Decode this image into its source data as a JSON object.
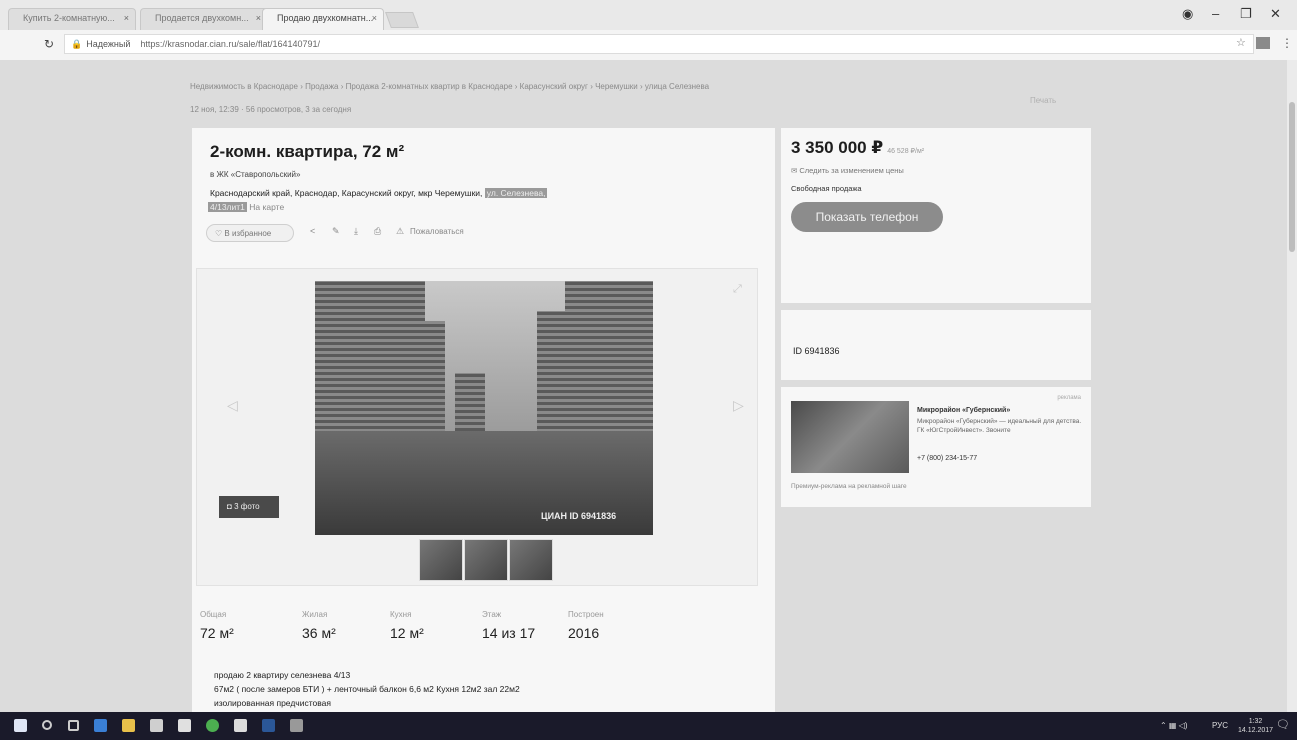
{
  "browser": {
    "tabs": [
      {
        "label": "Купить 2-комнатную..."
      },
      {
        "label": "Продается двухкомн..."
      },
      {
        "label": "Продаю двухкомнатн..."
      }
    ],
    "secure_label": "Надежный",
    "url": "https://krasnodar.cian.ru/sale/flat/164140791/"
  },
  "page": {
    "breadcrumbs": "Недвижимость в Краснодаре  ›  Продажа  ›  Продажа 2-комнатных квартир в Краснодаре  ›  Карасунский округ  ›  Черемушки  ›  улица Селезнева",
    "meta": "12 ноя, 12:39   ·   56 просмотров, 3 за сегодня",
    "print": "Печать"
  },
  "listing": {
    "title": "2-комн. квартира, 72 м²",
    "complex": "в ЖК «Ставропольский»",
    "address_main": "Краснодарский край, Краснодар, Карасунский округ, мкр Черемушки,",
    "address_street": "ул. Селезнева,",
    "address_house": "4/13лит1",
    "address_map": "На карте",
    "actions": {
      "favorite": "В избранное",
      "complain": "Пожаловаться"
    },
    "photo_count": "3 фото",
    "watermark": "ЦИАН  ID 6941836",
    "specs": [
      {
        "label": "Общая",
        "value": "72 м²"
      },
      {
        "label": "Жилая",
        "value": "36 м²"
      },
      {
        "label": "Кухня",
        "value": "12 м²"
      },
      {
        "label": "Этаж",
        "value": "14 из 17"
      },
      {
        "label": "Построен",
        "value": "2016"
      }
    ],
    "description": [
      "продаю 2 квартиру селезнева 4/13",
      "67м2 ( после замеров БТИ ) + ленточный балкон 6,6 м2 Кухня 12м2 зал 22м2",
      "изолированная предчистовая"
    ]
  },
  "sidebar": {
    "price": "3 350 000 ₽",
    "price_per": "46 528 ₽/м²",
    "notify": "Следить за изменением цены",
    "sale_type": "Свободная продажа",
    "phone_button": "Показать телефон",
    "id_label": "ID 6941836"
  },
  "ad": {
    "label": "реклама",
    "title": "Микрорайон «Губернский»",
    "text": "Микрорайон «Губернский» — идеальный для детства. ГК «ЮгСтройИнвест». Звоните",
    "tel": "+7 (800) 234-15-77",
    "footer": "Премиум-реклама на рекламной шаге"
  },
  "taskbar": {
    "lang": "РУС",
    "time": "1:32",
    "date": "14.12.2017"
  },
  "colors": {
    "accent_button": "#8c8c8c",
    "taskbar": "#1a1a2a"
  }
}
